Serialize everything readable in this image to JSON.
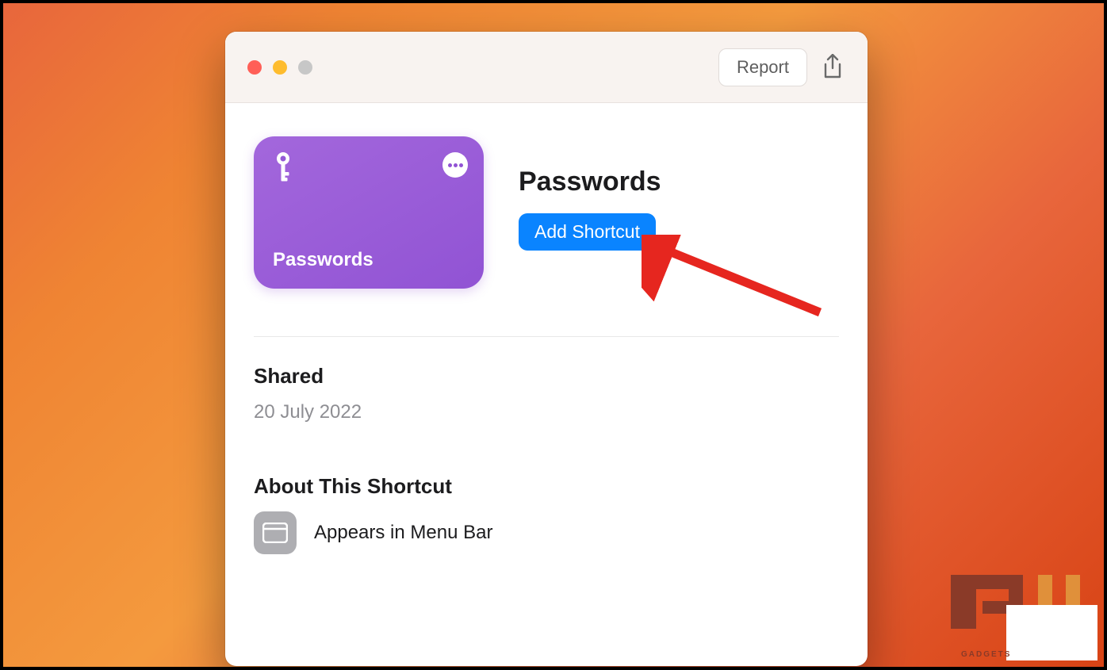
{
  "titlebar": {
    "report_label": "Report"
  },
  "shortcut": {
    "card_title": "Passwords",
    "title": "Passwords",
    "add_button_label": "Add Shortcut"
  },
  "shared": {
    "heading": "Shared",
    "date": "20 July 2022"
  },
  "about": {
    "heading": "About This Shortcut",
    "feature": "Appears in Menu Bar"
  },
  "watermark": {
    "brand": "GADGETS"
  },
  "colors": {
    "accent_purple": "#9153d4",
    "accent_blue": "#0a84ff",
    "bg_orange": "#e8663c"
  }
}
